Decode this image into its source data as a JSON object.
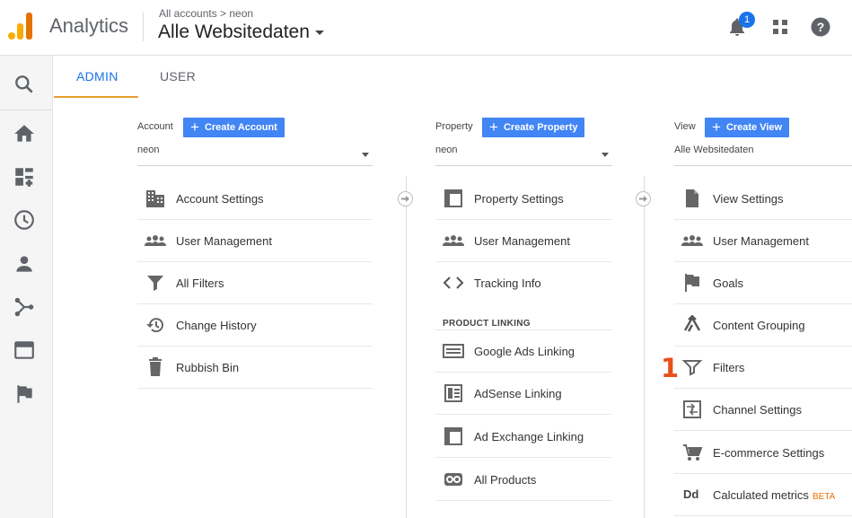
{
  "header": {
    "app_name": "Analytics",
    "breadcrumb": "All accounts > neon",
    "property_title": "Alle Websitedaten",
    "notification_count": "1"
  },
  "tabs": [
    {
      "label": "ADMIN",
      "active": true
    },
    {
      "label": "USER",
      "active": false
    }
  ],
  "account_column": {
    "label": "Account",
    "create_button": "Create Account",
    "selected": "neon",
    "items": [
      {
        "label": "Account Settings",
        "icon": "building-icon"
      },
      {
        "label": "User Management",
        "icon": "people-icon"
      },
      {
        "label": "All Filters",
        "icon": "filter-icon"
      },
      {
        "label": "Change History",
        "icon": "history-icon"
      },
      {
        "label": "Rubbish Bin",
        "icon": "trash-icon"
      }
    ]
  },
  "property_column": {
    "label": "Property",
    "create_button": "Create Property",
    "selected": "neon",
    "items": [
      {
        "label": "Property Settings",
        "icon": "window-icon"
      },
      {
        "label": "User Management",
        "icon": "people-icon"
      },
      {
        "label": "Tracking Info",
        "icon": "code-icon"
      }
    ],
    "section_heading": "PRODUCT LINKING",
    "linking_items": [
      {
        "label": "Google Ads Linking",
        "icon": "ads-icon"
      },
      {
        "label": "AdSense Linking",
        "icon": "adsense-icon"
      },
      {
        "label": "Ad Exchange Linking",
        "icon": "window-icon"
      },
      {
        "label": "All Products",
        "icon": "link-icon"
      }
    ]
  },
  "view_column": {
    "label": "View",
    "create_button": "Create View",
    "selected": "Alle Websitedaten",
    "items": [
      {
        "label": "View Settings",
        "icon": "document-icon"
      },
      {
        "label": "User Management",
        "icon": "people-icon"
      },
      {
        "label": "Goals",
        "icon": "flag-icon"
      },
      {
        "label": "Content Grouping",
        "icon": "grouping-icon"
      },
      {
        "label": "Filters",
        "icon": "filter-icon"
      },
      {
        "label": "Channel Settings",
        "icon": "channel-icon"
      },
      {
        "label": "E-commerce Settings",
        "icon": "cart-icon"
      },
      {
        "label": "Calculated metrics",
        "icon": "dd-icon",
        "badge": "BETA"
      }
    ]
  },
  "callout_number": "1",
  "colors": {
    "accent_blue": "#1a73e8",
    "button_blue": "#4285f4",
    "tab_underline": "#e8a030",
    "callout": "#e8501c",
    "beta": "#e8710a"
  }
}
